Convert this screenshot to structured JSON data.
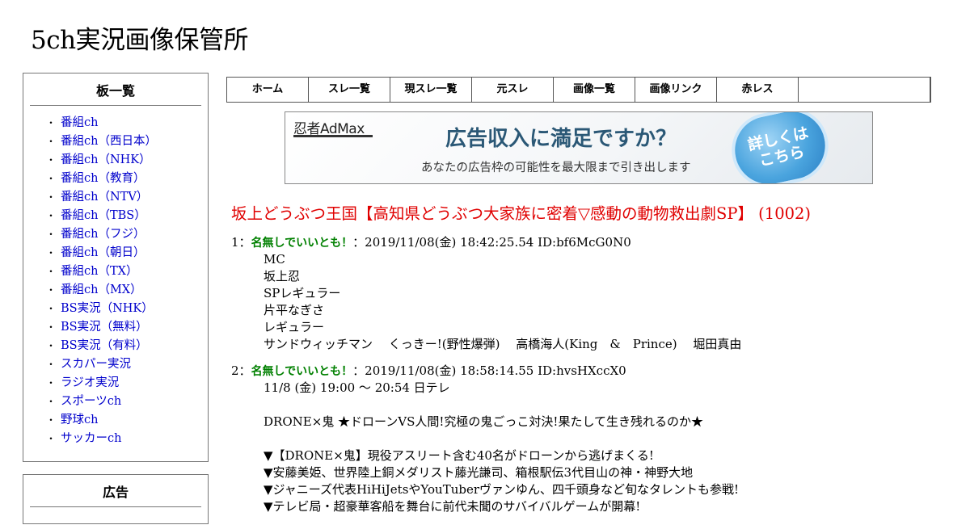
{
  "site": {
    "title": "5ch実況画像保管所"
  },
  "sidebar": {
    "board_title": "板一覧",
    "bullet": "・",
    "boards": [
      "番組ch",
      "番組ch（西日本）",
      "番組ch（NHK）",
      "番組ch（教育）",
      "番組ch（NTV）",
      "番組ch（TBS）",
      "番組ch（フジ）",
      "番組ch（朝日）",
      "番組ch（TX）",
      "番組ch（MX）",
      "BS実況（NHK）",
      "BS実況（無料）",
      "BS実況（有料）",
      "スカパー実況",
      "ラジオ実況",
      "スポーツch",
      "野球ch",
      "サッカーch"
    ],
    "ad_title": "広告"
  },
  "nav": {
    "items": [
      "ホーム",
      "スレ一覧",
      "現スレ一覧",
      "元スレ",
      "画像一覧",
      "画像リンク",
      "赤レス"
    ]
  },
  "ad": {
    "logo": "忍者AdMax",
    "headline": "広告収入に満足ですか？",
    "sub": "あなたの広告枠の可能性を最大限まで引き出します",
    "badge_line1": "詳しくは",
    "badge_line2": "こちら"
  },
  "thread": {
    "title": "坂上どうぶつ王国【高知県どうぶつ大家族に密着▽感動の動物救出劇SP】 (1002)"
  },
  "posts": [
    {
      "num": "1",
      "sep": "：",
      "name": "名無しでいいとも！",
      "meta": "：2019/11/08(金) 18:42:25.54 ID:bf6McG0N0",
      "lines": [
        "MC",
        "坂上忍",
        "SPレギュラー",
        "片平なぎさ",
        "レギュラー",
        "サンドウィッチマン　 くっきー!(野性爆弾)　 高橋海人(King　&　Prince)　 堀田真由"
      ]
    },
    {
      "num": "2",
      "sep": "：",
      "name": "名無しでいいとも！",
      "meta": "：2019/11/08(金) 18:58:14.55 ID:hvsHXccX0",
      "lines": [
        "11/8 (金) 19:00 ～ 20:54 日テレ",
        "",
        "DRONE×鬼 ★ドローンVS人間!究極の鬼ごっこ対決!果たして生き残れるのか★",
        "",
        "▼【DRONE×鬼】現役アスリート含む40名がドローンから逃げまくる!",
        "▼安藤美姫、世界陸上銅メダリスト藤光謙司、箱根駅伝3代目山の神・神野大地",
        "▼ジャニーズ代表HiHiJetsやYouTuberヴァンゆん、四千頭身など旬なタレントも参戦!",
        "▼テレビ局・超豪華客船を舞台に前代未聞のサバイバルゲームが開幕!"
      ]
    }
  ]
}
